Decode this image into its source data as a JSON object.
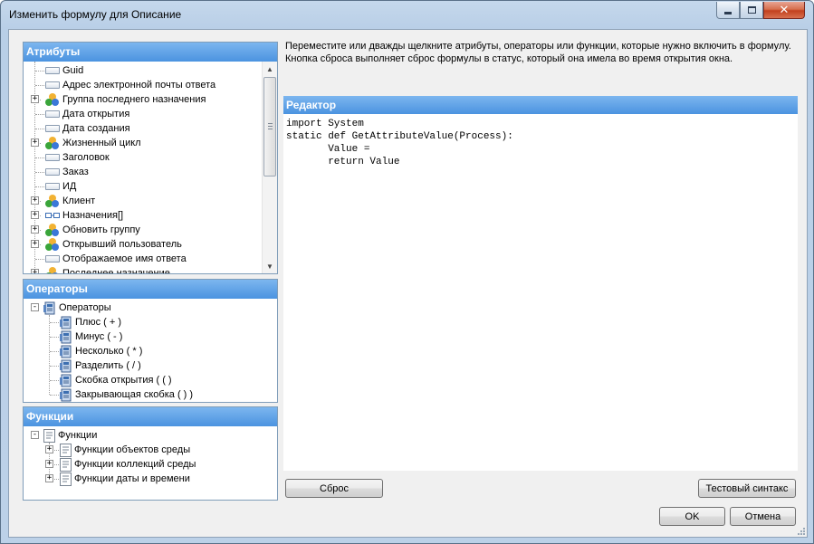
{
  "window": {
    "title": "Изменить формулу для Описание"
  },
  "attributes": {
    "header": "Атрибуты",
    "items": [
      {
        "label": "Guid",
        "icon": "field-icon",
        "expandable": false
      },
      {
        "label": "Адрес электронной почты ответа",
        "icon": "field-icon",
        "expandable": false
      },
      {
        "label": "Группа последнего назначения",
        "icon": "group-icon",
        "expandable": true
      },
      {
        "label": "Дата открытия",
        "icon": "field-icon",
        "expandable": false
      },
      {
        "label": "Дата создания",
        "icon": "field-icon",
        "expandable": false
      },
      {
        "label": "Жизненный цикл",
        "icon": "group-icon",
        "expandable": true
      },
      {
        "label": "Заголовок",
        "icon": "field-icon",
        "expandable": false
      },
      {
        "label": "Заказ",
        "icon": "field-icon",
        "expandable": false
      },
      {
        "label": "ИД",
        "icon": "field-icon",
        "expandable": false
      },
      {
        "label": "Клиент",
        "icon": "group-icon",
        "expandable": true
      },
      {
        "label": "Назначения[]",
        "icon": "list-icon",
        "expandable": true
      },
      {
        "label": "Обновить группу",
        "icon": "group-icon",
        "expandable": true
      },
      {
        "label": "Открывший пользователь",
        "icon": "group-icon",
        "expandable": true
      },
      {
        "label": "Отображаемое имя ответа",
        "icon": "field-icon",
        "expandable": false
      },
      {
        "label": "Последнее назначение",
        "icon": "group-icon",
        "expandable": true
      }
    ]
  },
  "operators": {
    "header": "Операторы",
    "root": "Операторы",
    "items": [
      "Плюс ( + )",
      "Минус ( - )",
      "Несколько ( * )",
      "Разделить ( / )",
      "Скобка открытия ( ( )",
      "Закрывающая скобка ( ) )"
    ]
  },
  "functions": {
    "header": "Функции",
    "root": "Функции",
    "items": [
      "Функции объектов среды",
      "Функции коллекций среды",
      "Функции даты и времени"
    ]
  },
  "instructions": "Переместите или дважды щелкните атрибуты, операторы или функции, которые нужно включить в формулу. Кнопка сброса выполняет сброс формулы в статус, который она имела во время открытия окна.",
  "editor": {
    "header": "Редактор",
    "code": "import System\nstatic def GetAttributeValue(Process):\n       Value =\n       return Value"
  },
  "buttons": {
    "reset": "Сброс",
    "test_syntax": "Тестовый синтакс",
    "ok": "OK",
    "cancel": "Отмена"
  }
}
